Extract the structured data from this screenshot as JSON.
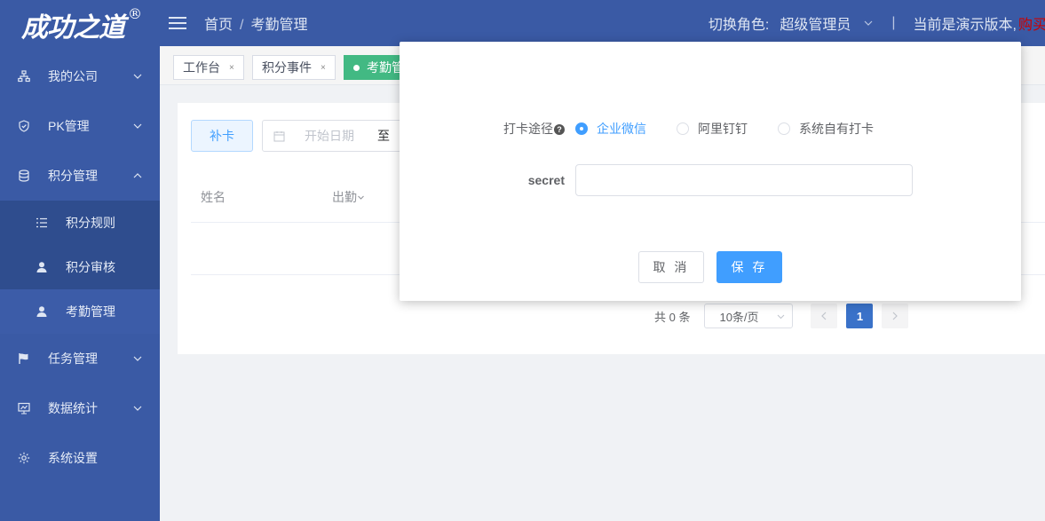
{
  "logo": {
    "text": "成功之道",
    "sup": "®"
  },
  "sidebar": {
    "items": [
      {
        "label": "我的公司",
        "icon": "org-icon",
        "expandable": true
      },
      {
        "label": "PK管理",
        "icon": "shield-icon",
        "expandable": true
      },
      {
        "label": "积分管理",
        "icon": "database-icon",
        "expandable": true,
        "expanded": true
      },
      {
        "label": "任务管理",
        "icon": "flag-icon",
        "expandable": true
      },
      {
        "label": "数据统计",
        "icon": "monitor-icon",
        "expandable": true
      },
      {
        "label": "系统设置",
        "icon": "gear-icon",
        "expandable": false
      }
    ],
    "subitems": [
      {
        "label": "积分规则",
        "icon": "list-icon"
      },
      {
        "label": "积分审核",
        "icon": "user-icon"
      },
      {
        "label": "考勤管理",
        "icon": "user-icon",
        "active": true
      }
    ]
  },
  "header": {
    "breadcrumb": [
      "首页",
      "考勤管理"
    ],
    "role_label": "切换角色:",
    "role_value": "超级管理员",
    "demo_text": "当前是演示版本,",
    "buy_text": "购买正版"
  },
  "tags": [
    {
      "label": "工作台",
      "active": false
    },
    {
      "label": "积分事件",
      "active": false
    },
    {
      "label": "考勤管",
      "active": true
    }
  ],
  "content": {
    "buka_button": "补卡",
    "date_start_placeholder": "开始日期",
    "date_to": "至",
    "columns": [
      "姓名",
      "出勤"
    ],
    "pager": {
      "total": "共 0 条",
      "page_size": "10条/页",
      "current_page": "1"
    }
  },
  "dialog": {
    "method_label": "打卡途径",
    "methods": [
      {
        "label": "企业微信",
        "checked": true
      },
      {
        "label": "阿里钉钉",
        "checked": false
      },
      {
        "label": "系统自有打卡",
        "checked": false
      }
    ],
    "secret_label": "secret",
    "secret_value": "",
    "cancel_label": "取 消",
    "save_label": "保 存"
  },
  "colors": {
    "sidebar_bg": "#3a5aa5",
    "primary": "#409eff",
    "tag_active": "#42b983",
    "buy_link": "#cc0000"
  }
}
